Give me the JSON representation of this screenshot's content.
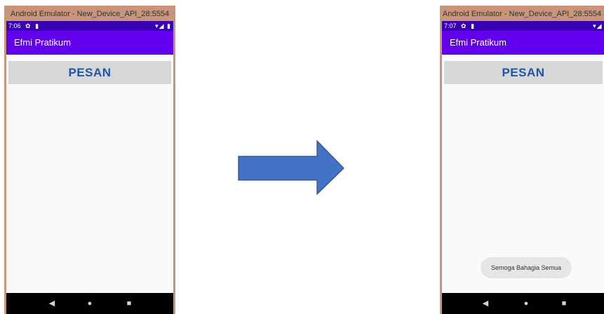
{
  "left_window": {
    "title": "Android Emulator - New_Device_API_28:5554",
    "status_time": "7:06",
    "status_left_icons": "✿ ▮",
    "status_right_icons": "▾◢ ▮",
    "app_title": "Efmi Pratikum",
    "button_label": "PESAN",
    "nav": {
      "back": "◀",
      "home": "●",
      "recents": "■"
    }
  },
  "right_window": {
    "title": "Android Emulator - New_Device_API_28:5554",
    "status_time": "7:07",
    "status_left_icons": "✿ ▮",
    "status_right_icons": "▾◢ ▮",
    "app_title": "Efmi Pratikum",
    "button_label": "PESAN",
    "toast": "Semoga Bahagia Semua",
    "nav": {
      "back": "◀",
      "home": "●",
      "recents": "■"
    }
  },
  "colors": {
    "status_bar": "#3700b3",
    "app_bar": "#6200ee",
    "button_text": "#1f55a8",
    "arrow_fill": "#4472c4"
  },
  "icons": [
    "settings-icon",
    "sim-card-icon",
    "wifi-icon",
    "signal-icon",
    "battery-icon",
    "back-icon",
    "home-icon",
    "recents-icon",
    "right-arrow-icon"
  ]
}
